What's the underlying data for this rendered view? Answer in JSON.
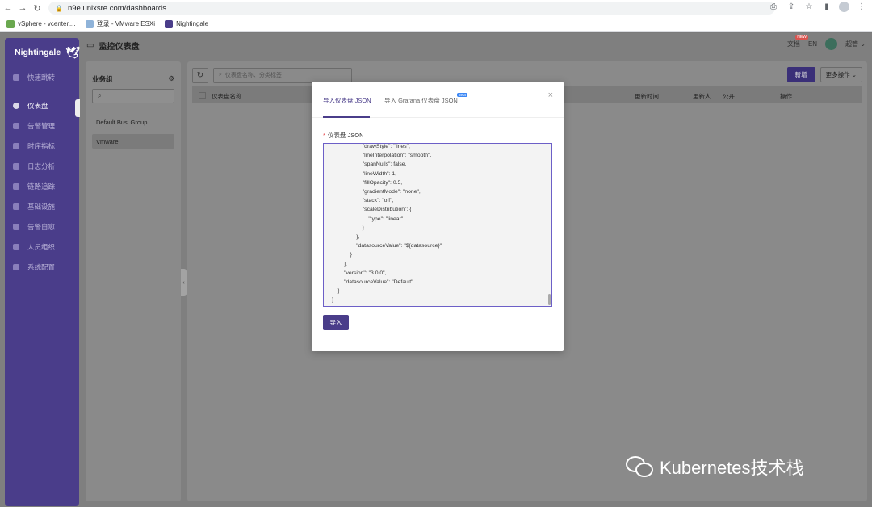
{
  "browser": {
    "url": "n9e.unixsre.com/dashboards",
    "bookmarks": [
      {
        "label": "vSphere - vcenter...."
      },
      {
        "label": "登录 - VMware ESXi"
      },
      {
        "label": "Nightingale"
      }
    ]
  },
  "sidebar": {
    "logo": "Nightingale",
    "items": [
      {
        "label": "快速跳转"
      },
      {
        "label": "仪表盘"
      },
      {
        "label": "告警管理"
      },
      {
        "label": "时序指标"
      },
      {
        "label": "日志分析"
      },
      {
        "label": "链路追踪"
      },
      {
        "label": "基础设施"
      },
      {
        "label": "告警自愈"
      },
      {
        "label": "人员组织"
      },
      {
        "label": "系统配置"
      }
    ]
  },
  "header": {
    "title": "监控仪表盘",
    "docs_label": "文档",
    "new_badge": "NEW",
    "lang": "EN",
    "user": "超管"
  },
  "business_group": {
    "title": "业务组",
    "search_placeholder": "",
    "items": [
      {
        "label": "Default Busi Group"
      },
      {
        "label": "Vmware"
      }
    ]
  },
  "toolbar": {
    "search_placeholder": "仪表盘名称、分类标签",
    "new_label": "新增",
    "more_label": "更多操作"
  },
  "table": {
    "columns": [
      "仪表盘名称",
      "更新时间",
      "更新人",
      "公开",
      "操作"
    ]
  },
  "modal": {
    "tab_json": "导入仪表盘 JSON",
    "tab_grafana": "导入 Grafana 仪表盘 JSON",
    "beta": "Beta",
    "field_label": "仪表盘 JSON",
    "json_text": "                    \"drawStyle\": \"lines\",\n                    \"lineInterpolation\": \"smooth\",\n                    \"spanNulls\": false,\n                    \"lineWidth\": 1,\n                    \"fillOpacity\": 0.5,\n                    \"gradientMode\": \"none\",\n                    \"stack\": \"off\",\n                    \"scaleDistribution\": {\n                        \"type\": \"linear\"\n                    }\n                },\n                \"datasourceValue\": \"${datasource}\"\n            }\n        ],\n        \"version\": \"3.0.0\",\n        \"datasourceValue\": \"Default\"\n    }\n}",
    "import_label": "导入"
  },
  "watermark": "Kubernetes技术栈"
}
